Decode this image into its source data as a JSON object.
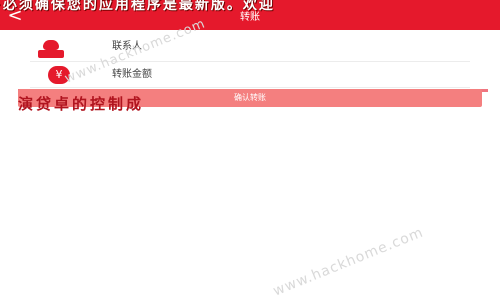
{
  "header": {
    "title": "转账",
    "back_glyph": "<",
    "bg_color": "#e5192c"
  },
  "banner": {
    "top_text": "·必须确保您的应用程序是最新版。欢迎",
    "mid_text": "演贷卓的控制成"
  },
  "form": {
    "contact_label": "联系人",
    "amount_label": "转账金额",
    "amount_icon": "¥"
  },
  "submit": {
    "label": "确认转账"
  },
  "watermark": {
    "text": "www.hackhome.com"
  },
  "colors": {
    "accent": "#e5192c",
    "button": "#f47f7f"
  }
}
